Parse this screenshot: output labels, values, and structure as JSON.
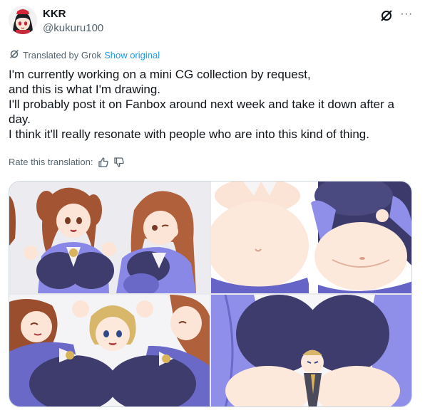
{
  "author": {
    "name": "KKR",
    "handle": "@kukuru100",
    "avatar_icon": "anime-avatar-icon"
  },
  "header_actions": {
    "grok_icon": "grok-icon",
    "more_icon": "more-dots-icon",
    "more_label": "···"
  },
  "translation": {
    "translated_by": "Translated by Grok",
    "show_original": "Show original"
  },
  "tweet": {
    "lines": [
      "I'm currently working on a mini CG collection by request,",
      "and this is what I'm drawing.",
      "I'll probably post it on Fanbox around next week and take it down after a",
      "day.",
      "I think it'll really resonate with people who are into this kind of thing."
    ]
  },
  "rating": {
    "label": "Rate this translation:",
    "thumbs_up_icon": "thumbs-up-icon",
    "thumbs_down_icon": "thumbs-down-icon"
  },
  "media": {
    "images": [
      {
        "name": "media-image-1"
      },
      {
        "name": "media-image-2"
      },
      {
        "name": "media-image-3"
      },
      {
        "name": "media-image-4"
      }
    ]
  },
  "colors": {
    "link": "#1d9bf0",
    "secondary_text": "#536471",
    "uniform_purple": "#8f8ee8",
    "uniform_navy": "#3b3a6b",
    "skin": "#fbe3d6",
    "hair_brown": "#b0603a"
  }
}
